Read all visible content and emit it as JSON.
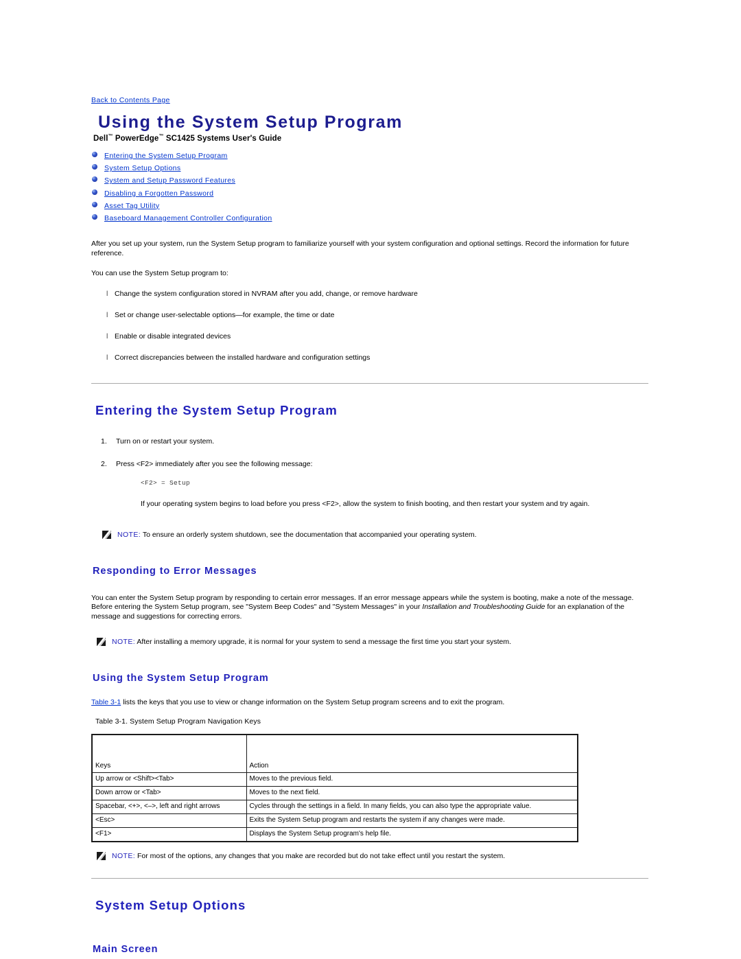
{
  "back_link": "Back to Contents Page",
  "title": "Using the System Setup Program",
  "subtitle_parts": {
    "dell": "Dell",
    "tm1": "™",
    "poweredge": " PowerEdge",
    "tm2": "™",
    "rest": " SC1425 Systems User's Guide"
  },
  "colors": {
    "title_blue": "#1d1d8f",
    "heading_blue": "#2222bb",
    "link_blue": "#0033cc",
    "rule_gray": "#a9a9a9",
    "table_border": "#1a1a1a"
  },
  "toc": [
    "Entering the System Setup Program",
    "System Setup Options",
    "System and Setup Password Features",
    "Disabling a Forgotten Password",
    "Asset Tag Utility",
    "Baseboard Management Controller Configuration"
  ],
  "intro": {
    "para1": "After you set up your system, run the System Setup program to familiarize yourself with your system configuration and optional settings. Record the information for future reference.",
    "para2": "You can use the System Setup program to:",
    "bullets": [
      "Change the system configuration stored in NVRAM after you add, change, or remove hardware",
      "Set or change user-selectable options—for example, the time or date",
      "Enable or disable integrated devices",
      "Correct discrepancies between the installed hardware and configuration settings"
    ],
    "bullet_marker": "l"
  },
  "entering_section": {
    "heading": "Entering the System Setup Program",
    "steps": [
      {
        "num": "1.",
        "text": "Turn on or restart your system."
      },
      {
        "num": "2.",
        "text": "Press <F2> immediately after you see the following message:"
      }
    ],
    "code": "<F2> = Setup",
    "after_code": "If your operating system begins to load before you press <F2>, allow the system to finish booting, and then restart your system and try again.",
    "note_label": "NOTE:",
    "note_text": " To ensure an orderly system shutdown, see the documentation that accompanied your operating system."
  },
  "responding_section": {
    "heading": "Responding to Error Messages",
    "para_a": "You can enter the System Setup program by responding to certain error messages. If an error message appears while the system is booting, make a note of the message. Before entering the System Setup program, see \"System Beep Codes\" and \"System Messages\" in your ",
    "para_italic": "Installation and Troubleshooting Guide",
    "para_b": " for an explanation of the message and suggestions for correcting errors.",
    "note_label": "NOTE:",
    "note_text": " After installing a memory upgrade, it is normal for your system to send a message the first time you start your system."
  },
  "using_section": {
    "heading": "Using the System Setup Program",
    "table_link": "Table 3-1",
    "lead_rest": " lists the keys that you use to view or change information on the System Setup program screens and to exit the program.",
    "table_caption": "Table 3-1. System Setup Program Navigation Keys",
    "table": {
      "columns": [
        "Keys",
        "Action"
      ],
      "rows": [
        [
          "Up arrow or <Shift><Tab>",
          "Moves to the previous field."
        ],
        [
          "Down arrow or <Tab>",
          "Moves to the next field."
        ],
        [
          "Spacebar, <+>, <–>, left and right arrows",
          "Cycles through the settings in a field. In many fields, you can also type the appropriate value."
        ],
        [
          "<Esc>",
          "Exits the System Setup program and restarts the system if any changes were made."
        ],
        [
          "<F1>",
          "Displays the System Setup program's help file."
        ]
      ]
    },
    "note_label": "NOTE:",
    "note_text": " For most of the options, any changes that you make are recorded but do not take effect until you restart the system."
  },
  "options_section": {
    "heading": "System Setup Options",
    "subheading": "Main Screen"
  }
}
